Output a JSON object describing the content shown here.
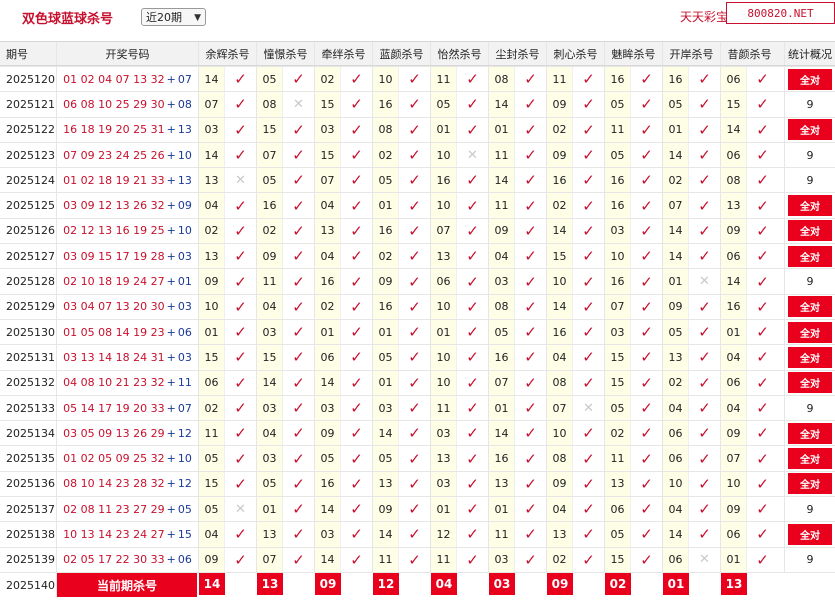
{
  "page_title": "双色球蓝球杀号",
  "range_select": {
    "selected": "近20期"
  },
  "site_name": "天天彩宝贝,",
  "watermark": "800820.NET",
  "headers": {
    "issue": "期号",
    "numbers": "开奖号码",
    "experts": [
      "余辉杀号",
      "憧憬杀号",
      "牵绊杀号",
      "蓝颜杀号",
      "怡然杀号",
      "尘封杀号",
      "刺心杀号",
      "魅眸杀号",
      "开岸杀号",
      "昔颜杀号"
    ],
    "stat": "统计概况"
  },
  "rows": [
    {
      "issue": "2025120",
      "red": "01 02 04 07 13 32",
      "blue": "07",
      "kills": [
        "14",
        "05",
        "02",
        "10",
        "11",
        "08",
        "11",
        "16",
        "16",
        "06"
      ],
      "marks": [
        1,
        1,
        1,
        1,
        1,
        1,
        1,
        1,
        1,
        1
      ],
      "stat": "全对"
    },
    {
      "issue": "2025121",
      "red": "06 08 10 25 29 30",
      "blue": "08",
      "kills": [
        "07",
        "08",
        "15",
        "16",
        "05",
        "14",
        "09",
        "05",
        "05",
        "15"
      ],
      "marks": [
        1,
        0,
        1,
        1,
        1,
        1,
        1,
        1,
        1,
        1
      ],
      "stat": "9"
    },
    {
      "issue": "2025122",
      "red": "16 18 19 20 25 31",
      "blue": "13",
      "kills": [
        "03",
        "15",
        "03",
        "08",
        "01",
        "01",
        "02",
        "11",
        "01",
        "14"
      ],
      "marks": [
        1,
        1,
        1,
        1,
        1,
        1,
        1,
        1,
        1,
        1
      ],
      "stat": "全对"
    },
    {
      "issue": "2025123",
      "red": "07 09 23 24 25 26",
      "blue": "10",
      "kills": [
        "14",
        "07",
        "15",
        "02",
        "10",
        "11",
        "09",
        "05",
        "14",
        "06"
      ],
      "marks": [
        1,
        1,
        1,
        1,
        0,
        1,
        1,
        1,
        1,
        1
      ],
      "stat": "9"
    },
    {
      "issue": "2025124",
      "red": "01 02 18 19 21 33",
      "blue": "13",
      "kills": [
        "13",
        "05",
        "07",
        "05",
        "16",
        "14",
        "16",
        "16",
        "02",
        "08"
      ],
      "marks": [
        0,
        1,
        1,
        1,
        1,
        1,
        1,
        1,
        1,
        1
      ],
      "stat": "9"
    },
    {
      "issue": "2025125",
      "red": "03 09 12 13 26 32",
      "blue": "09",
      "kills": [
        "04",
        "16",
        "04",
        "01",
        "10",
        "11",
        "02",
        "16",
        "07",
        "13"
      ],
      "marks": [
        1,
        1,
        1,
        1,
        1,
        1,
        1,
        1,
        1,
        1
      ],
      "stat": "全对"
    },
    {
      "issue": "2025126",
      "red": "02 12 13 16 19 25",
      "blue": "10",
      "kills": [
        "02",
        "02",
        "13",
        "16",
        "07",
        "09",
        "14",
        "03",
        "14",
        "09"
      ],
      "marks": [
        1,
        1,
        1,
        1,
        1,
        1,
        1,
        1,
        1,
        1
      ],
      "stat": "全对"
    },
    {
      "issue": "2025127",
      "red": "03 09 15 17 19 28",
      "blue": "03",
      "kills": [
        "13",
        "09",
        "04",
        "02",
        "13",
        "04",
        "15",
        "10",
        "14",
        "06"
      ],
      "marks": [
        1,
        1,
        1,
        1,
        1,
        1,
        1,
        1,
        1,
        1
      ],
      "stat": "全对"
    },
    {
      "issue": "2025128",
      "red": "02 10 18 19 24 27",
      "blue": "01",
      "kills": [
        "09",
        "11",
        "16",
        "09",
        "06",
        "03",
        "10",
        "16",
        "01",
        "14"
      ],
      "marks": [
        1,
        1,
        1,
        1,
        1,
        1,
        1,
        1,
        0,
        1
      ],
      "stat": "9"
    },
    {
      "issue": "2025129",
      "red": "03 04 07 13 20 30",
      "blue": "03",
      "kills": [
        "10",
        "04",
        "02",
        "16",
        "10",
        "08",
        "14",
        "07",
        "09",
        "16"
      ],
      "marks": [
        1,
        1,
        1,
        1,
        1,
        1,
        1,
        1,
        1,
        1
      ],
      "stat": "全对"
    },
    {
      "issue": "2025130",
      "red": "01 05 08 14 19 23",
      "blue": "06",
      "kills": [
        "01",
        "03",
        "01",
        "01",
        "01",
        "05",
        "16",
        "03",
        "05",
        "01"
      ],
      "marks": [
        1,
        1,
        1,
        1,
        1,
        1,
        1,
        1,
        1,
        1
      ],
      "stat": "全对"
    },
    {
      "issue": "2025131",
      "red": "03 13 14 18 24 31",
      "blue": "03",
      "kills": [
        "15",
        "15",
        "06",
        "05",
        "10",
        "16",
        "04",
        "15",
        "13",
        "04"
      ],
      "marks": [
        1,
        1,
        1,
        1,
        1,
        1,
        1,
        1,
        1,
        1
      ],
      "stat": "全对"
    },
    {
      "issue": "2025132",
      "red": "04 08 10 21 23 32",
      "blue": "11",
      "kills": [
        "06",
        "14",
        "14",
        "01",
        "10",
        "07",
        "08",
        "15",
        "02",
        "06"
      ],
      "marks": [
        1,
        1,
        1,
        1,
        1,
        1,
        1,
        1,
        1,
        1
      ],
      "stat": "全对"
    },
    {
      "issue": "2025133",
      "red": "05 14 17 19 20 33",
      "blue": "07",
      "kills": [
        "02",
        "03",
        "03",
        "03",
        "11",
        "01",
        "07",
        "05",
        "04",
        "04"
      ],
      "marks": [
        1,
        1,
        1,
        1,
        1,
        1,
        0,
        1,
        1,
        1
      ],
      "stat": "9"
    },
    {
      "issue": "2025134",
      "red": "03 05 09 13 26 29",
      "blue": "12",
      "kills": [
        "11",
        "04",
        "09",
        "14",
        "03",
        "14",
        "10",
        "02",
        "06",
        "09"
      ],
      "marks": [
        1,
        1,
        1,
        1,
        1,
        1,
        1,
        1,
        1,
        1
      ],
      "stat": "全对"
    },
    {
      "issue": "2025135",
      "red": "01 02 05 09 25 32",
      "blue": "10",
      "kills": [
        "05",
        "03",
        "05",
        "05",
        "13",
        "16",
        "08",
        "11",
        "06",
        "07"
      ],
      "marks": [
        1,
        1,
        1,
        1,
        1,
        1,
        1,
        1,
        1,
        1
      ],
      "stat": "全对"
    },
    {
      "issue": "2025136",
      "red": "08 10 14 23 28 32",
      "blue": "12",
      "kills": [
        "15",
        "05",
        "16",
        "13",
        "03",
        "13",
        "09",
        "13",
        "10",
        "10"
      ],
      "marks": [
        1,
        1,
        1,
        1,
        1,
        1,
        1,
        1,
        1,
        1
      ],
      "stat": "全对"
    },
    {
      "issue": "2025137",
      "red": "02 08 11 23 27 29",
      "blue": "05",
      "kills": [
        "05",
        "01",
        "14",
        "09",
        "01",
        "01",
        "04",
        "06",
        "04",
        "09"
      ],
      "marks": [
        0,
        1,
        1,
        1,
        1,
        1,
        1,
        1,
        1,
        1
      ],
      "stat": "9"
    },
    {
      "issue": "2025138",
      "red": "10 13 14 23 24 27",
      "blue": "15",
      "kills": [
        "04",
        "13",
        "03",
        "14",
        "12",
        "11",
        "13",
        "05",
        "14",
        "06"
      ],
      "marks": [
        1,
        1,
        1,
        1,
        1,
        1,
        1,
        1,
        1,
        1
      ],
      "stat": "全对"
    },
    {
      "issue": "2025139",
      "red": "02 05 17 22 30 33",
      "blue": "06",
      "kills": [
        "09",
        "07",
        "14",
        "11",
        "11",
        "03",
        "02",
        "15",
        "06",
        "01"
      ],
      "marks": [
        1,
        1,
        1,
        1,
        1,
        1,
        1,
        1,
        0,
        1
      ],
      "stat": "9"
    }
  ],
  "current": {
    "issue": "2025140",
    "label": "当前期杀号",
    "picks": [
      "14",
      "13",
      "09",
      "12",
      "04",
      "03",
      "09",
      "02",
      "01",
      "13"
    ]
  },
  "colors": {
    "accent": "#c8102e",
    "badge": "#e8001c",
    "blue_ball": "#1a3a9a",
    "kill_bg": "#fefde6"
  }
}
